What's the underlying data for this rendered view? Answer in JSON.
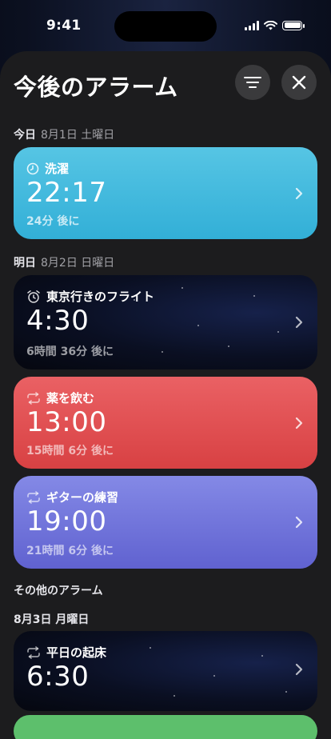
{
  "status": {
    "time": "9:41"
  },
  "sheet": {
    "title": "今後のアラーム",
    "filter_icon": "filter-lines-icon",
    "close_icon": "close-icon"
  },
  "sections": {
    "today": {
      "label": "今日",
      "date": "8月1日 土曜日"
    },
    "tomorrow": {
      "label": "明日",
      "date": "8月2日 日曜日"
    },
    "other": {
      "label": "その他のアラーム"
    },
    "aug3": {
      "label": "8月3日 月曜日"
    }
  },
  "alarms": [
    {
      "name": "洗濯",
      "time": "22:17",
      "relative": "24分 後に",
      "icon": "clock-icon",
      "color": "#3bb7db"
    },
    {
      "name": "東京行きのフライト",
      "time": "4:30",
      "relative": "6時間 36分 後に",
      "icon": "alarm-clock-icon",
      "color": "#0a0f22"
    },
    {
      "name": "薬を飲む",
      "time": "13:00",
      "relative": "15時間 6分 後に",
      "icon": "repeat-icon",
      "color": "#e04f52"
    },
    {
      "name": "ギターの練習",
      "time": "19:00",
      "relative": "21時間 6分 後に",
      "icon": "repeat-icon",
      "color": "#6e72db"
    },
    {
      "name": "平日の起床",
      "time": "6:30",
      "relative": "",
      "icon": "repeat-icon",
      "color": "#0a0f22"
    }
  ]
}
